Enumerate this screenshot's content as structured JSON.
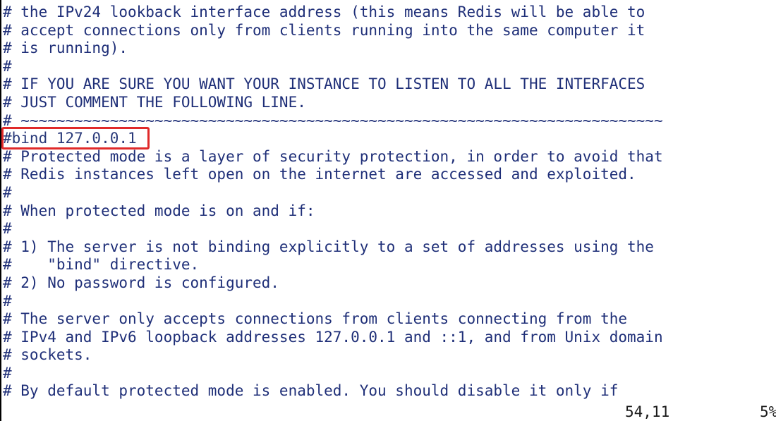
{
  "editor": {
    "lines": [
      "# the IPv24 lookback interface address (this means Redis will be able to",
      "# accept connections only from clients running into the same computer it",
      "# is running).",
      "#",
      "# IF YOU ARE SURE YOU WANT YOUR INSTANCE TO LISTEN TO ALL THE INTERFACES",
      "# JUST COMMENT THE FOLLOWING LINE.",
      "# ~~~~~~~~~~~~~~~~~~~~~~~~~~~~~~~~~~~~~~~~~~~~~~~~~~~~~~~~~~~~~~~~~~~~~~~~",
      "#bind 127.0.0.1",
      "# Protected mode is a layer of security protection, in order to avoid that",
      "# Redis instances left open on the internet are accessed and exploited.",
      "#",
      "# When protected mode is on and if:",
      "#",
      "# 1) The server is not binding explicitly to a set of addresses using the",
      "#    \"bind\" directive.",
      "# 2) No password is configured.",
      "#",
      "# The server only accepts connections from clients connecting from the",
      "# IPv4 and IPv6 loopback addresses 127.0.0.1 and ::1, and from Unix domain",
      "# sockets.",
      "#",
      "# By default protected mode is enabled. You should disable it only if"
    ]
  },
  "status": {
    "position": "54,11",
    "percent": "5%"
  },
  "colors": {
    "text": "#1f2f78",
    "highlight": "#e02a2a",
    "background": "#ffffff"
  }
}
